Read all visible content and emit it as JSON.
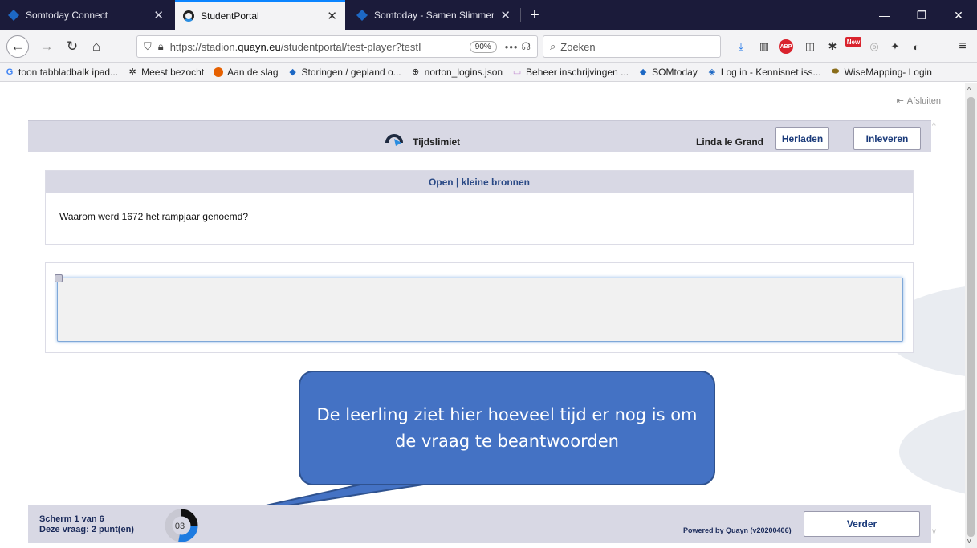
{
  "tabs": [
    {
      "title": "Somtoday Connect",
      "icon": "somtoday-icon"
    },
    {
      "title": "StudentPortal",
      "icon": "quayn-icon",
      "active": true
    },
    {
      "title": "Somtoday - Samen Slimmer Or",
      "icon": "somtoday-icon"
    }
  ],
  "window": {
    "minimize": "—",
    "restore": "❐",
    "close": "✕"
  },
  "nav": {
    "url_prefix": "https://stadion.",
    "url_domain": "quayn.eu",
    "url_path": "/studentportal/test-player?testI",
    "zoom": "90%",
    "more": "•••",
    "search_placeholder": "Zoeken"
  },
  "bookmarks": [
    {
      "label": "toon tabbladbalk ipad...",
      "icon": "google-icon"
    },
    {
      "label": "Meest bezocht",
      "icon": "gear-icon"
    },
    {
      "label": "Aan de slag",
      "icon": "firefox-icon"
    },
    {
      "label": "Storingen / gepland o...",
      "icon": "somtoday-icon"
    },
    {
      "label": "norton_logins.json",
      "icon": "globe-icon"
    },
    {
      "label": "Beheer inschrijvingen ...",
      "icon": "folder-icon"
    },
    {
      "label": "SOMtoday",
      "icon": "somtoday-icon"
    },
    {
      "label": "Log in - Kennisnet iss...",
      "icon": "kennisnet-icon"
    },
    {
      "label": "WiseMapping- Login",
      "icon": "wisemapping-icon"
    }
  ],
  "page": {
    "afsluiten": "Afsluiten",
    "header": {
      "title": "Tijdslimiet",
      "student": "Linda le Grand",
      "reload": "Herladen",
      "submit": "Inleveren"
    },
    "question": {
      "heading": "Open | kleine bronnen",
      "text": "Waarom werd 1672 het rampjaar genoemd?"
    },
    "answer": {
      "value": ""
    },
    "callout": "De leerling ziet hier hoeveel tijd er nog is om de vraag te beantwoorden",
    "footer": {
      "screen": "Scherm 1 van 6",
      "points": "Deze vraag: 2 punt(en)",
      "timer": "03",
      "timer_remaining_fraction": 0.25,
      "powered": "Powered by Quayn (v20200406)",
      "next": "Verder"
    }
  },
  "colors": {
    "accent": "#4472c4",
    "header_bg": "#d8d8e4",
    "tabstrip": "#1b1b3a"
  }
}
